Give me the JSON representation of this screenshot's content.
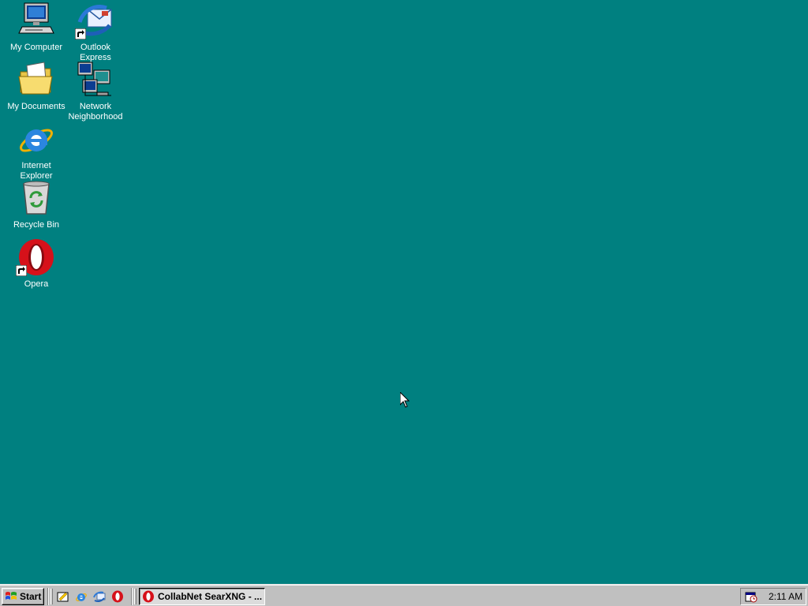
{
  "desktop": {
    "background_color": "#008080",
    "icons": {
      "my_computer": {
        "label": "My Computer",
        "icon": "my-computer-icon"
      },
      "outlook_express": {
        "label": "Outlook Express",
        "icon": "outlook-express-icon"
      },
      "my_documents": {
        "label": "My Documents",
        "icon": "my-documents-icon"
      },
      "network_neighborhood": {
        "label": "Network\nNeighborhood",
        "icon": "network-neighborhood-icon"
      },
      "internet_explorer": {
        "label": "Internet Explorer",
        "icon": "internet-explorer-icon"
      },
      "recycle_bin": {
        "label": "Recycle Bin",
        "icon": "recycle-bin-icon"
      },
      "opera": {
        "label": "Opera",
        "icon": "opera-icon"
      }
    }
  },
  "taskbar": {
    "start_label": "Start",
    "quick_launch": [
      "show-desktop-icon",
      "internet-explorer-icon",
      "outlook-express-icon",
      "opera-icon"
    ],
    "task_button_label": "CollabNet SearXNG - ...",
    "clock": "2:11 AM"
  }
}
